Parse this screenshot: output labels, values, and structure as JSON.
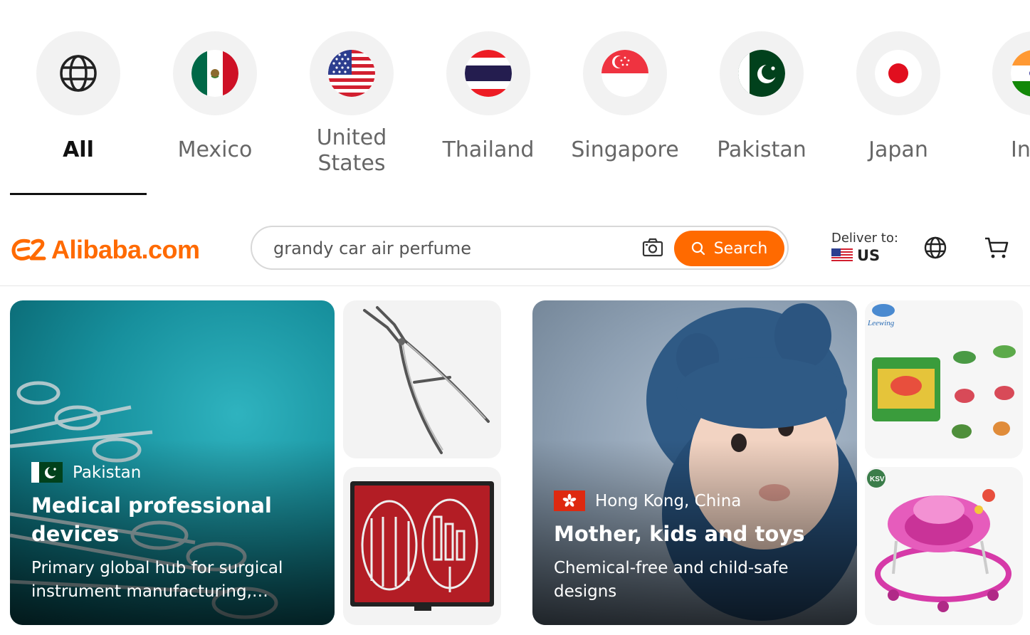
{
  "countries": [
    {
      "label": "All",
      "icon": "globe-icon",
      "active": true
    },
    {
      "label": "Mexico",
      "icon": "mexico-flag-icon"
    },
    {
      "label": "United States",
      "line1": "United",
      "line2": "States",
      "icon": "us-flag-icon"
    },
    {
      "label": "Thailand",
      "icon": "thailand-flag-icon"
    },
    {
      "label": "Singapore",
      "icon": "singapore-flag-icon"
    },
    {
      "label": "Pakistan",
      "icon": "pakistan-flag-icon"
    },
    {
      "label": "Japan",
      "icon": "japan-flag-icon"
    },
    {
      "label": "In",
      "icon": "india-flag-icon"
    }
  ],
  "header": {
    "logo_text": "Alibaba.com",
    "search_placeholder": "grandy car air perfume",
    "search_button_label": "Search",
    "deliver_label": "Deliver to:",
    "deliver_country": "US"
  },
  "cards": [
    {
      "country": "Pakistan",
      "title": "Medical professional devices",
      "subtitle": "Primary global hub for surgical instrument manufacturing, precision tools and more"
    },
    {
      "country": "Hong Kong, China",
      "title": "Mother, kids and toys",
      "subtitle": "Chemical-free and child-safe designs"
    }
  ],
  "product_labels": {
    "toy_brand": "Leewing",
    "walker_brand": "KSV"
  },
  "colors": {
    "brand_orange": "#ff6a00",
    "tab_active": "#111111",
    "tab_inactive": "#666666"
  }
}
